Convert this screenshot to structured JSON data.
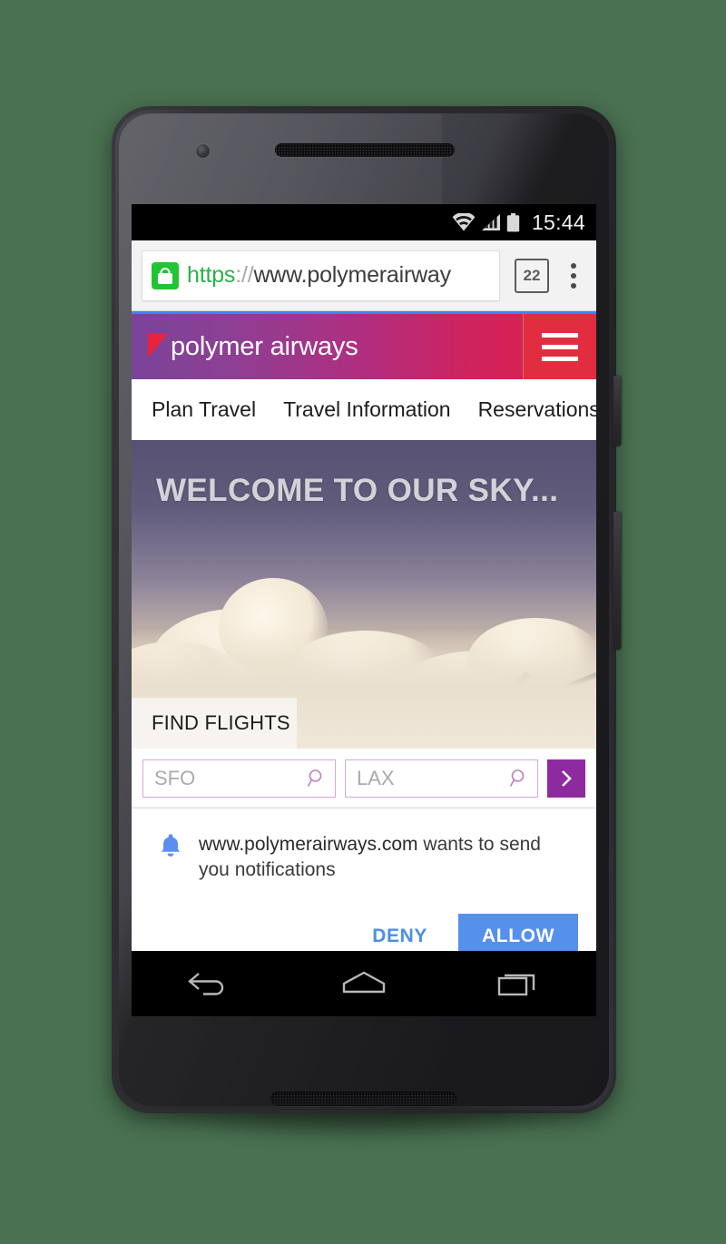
{
  "background_color": "#4A7252",
  "device": {
    "name": "android-phone",
    "components": {
      "earpiece": "earpiece-speaker",
      "front_camera": "front-camera",
      "bottom_speaker": "bottom-speaker",
      "power_button": "power-button",
      "volume_button": "volume-rocker"
    }
  },
  "status_bar": {
    "clock": "15:44",
    "icons": [
      "wifi-icon",
      "cellular-signal-icon",
      "battery-icon"
    ]
  },
  "browser": {
    "url": {
      "scheme": "https",
      "separator": "://",
      "host": "www.polymerairway",
      "full": "https://www.polymerairways.com"
    },
    "lock_icon": "lock-icon",
    "secure": true,
    "tab_count": "22",
    "overflow_icon": "overflow-menu-icon",
    "accent_secure": "#21c531",
    "progress_color": "#3b86f7"
  },
  "site": {
    "brand": "polymer airways",
    "brand_mark": "flag-triangle-icon",
    "menu_icon": "hamburger-menu-icon",
    "gradient_start": "#7a4499",
    "gradient_end": "#de2044",
    "menu_button_color": "#e12d3f",
    "nav": [
      {
        "label": "Plan Travel"
      },
      {
        "label": "Travel Information"
      },
      {
        "label": "Reservations"
      }
    ],
    "hero": {
      "title": "WELCOME TO OUR SKY...",
      "image_alt": "airplane-wing-above-clouds"
    },
    "find_flights": {
      "tab_label": "FIND FLIGHTS",
      "origin": {
        "value": "SFO",
        "placeholder": "SFO",
        "icon": "search-icon"
      },
      "destination": {
        "value": "LAX",
        "placeholder": "LAX",
        "icon": "search-icon"
      },
      "submit_icon": "chevron-right-icon",
      "submit_color": "#8e2aa0"
    }
  },
  "permission_dialog": {
    "icon": "bell-icon",
    "origin": "www.polymerairways.com",
    "message": " wants to send you notifications",
    "deny_label": "DENY",
    "allow_label": "ALLOW",
    "allow_color": "#5490ec",
    "deny_color": "#4a90e2"
  },
  "android_nav": {
    "back": "back-icon",
    "home": "home-icon",
    "recents": "recents-icon"
  }
}
